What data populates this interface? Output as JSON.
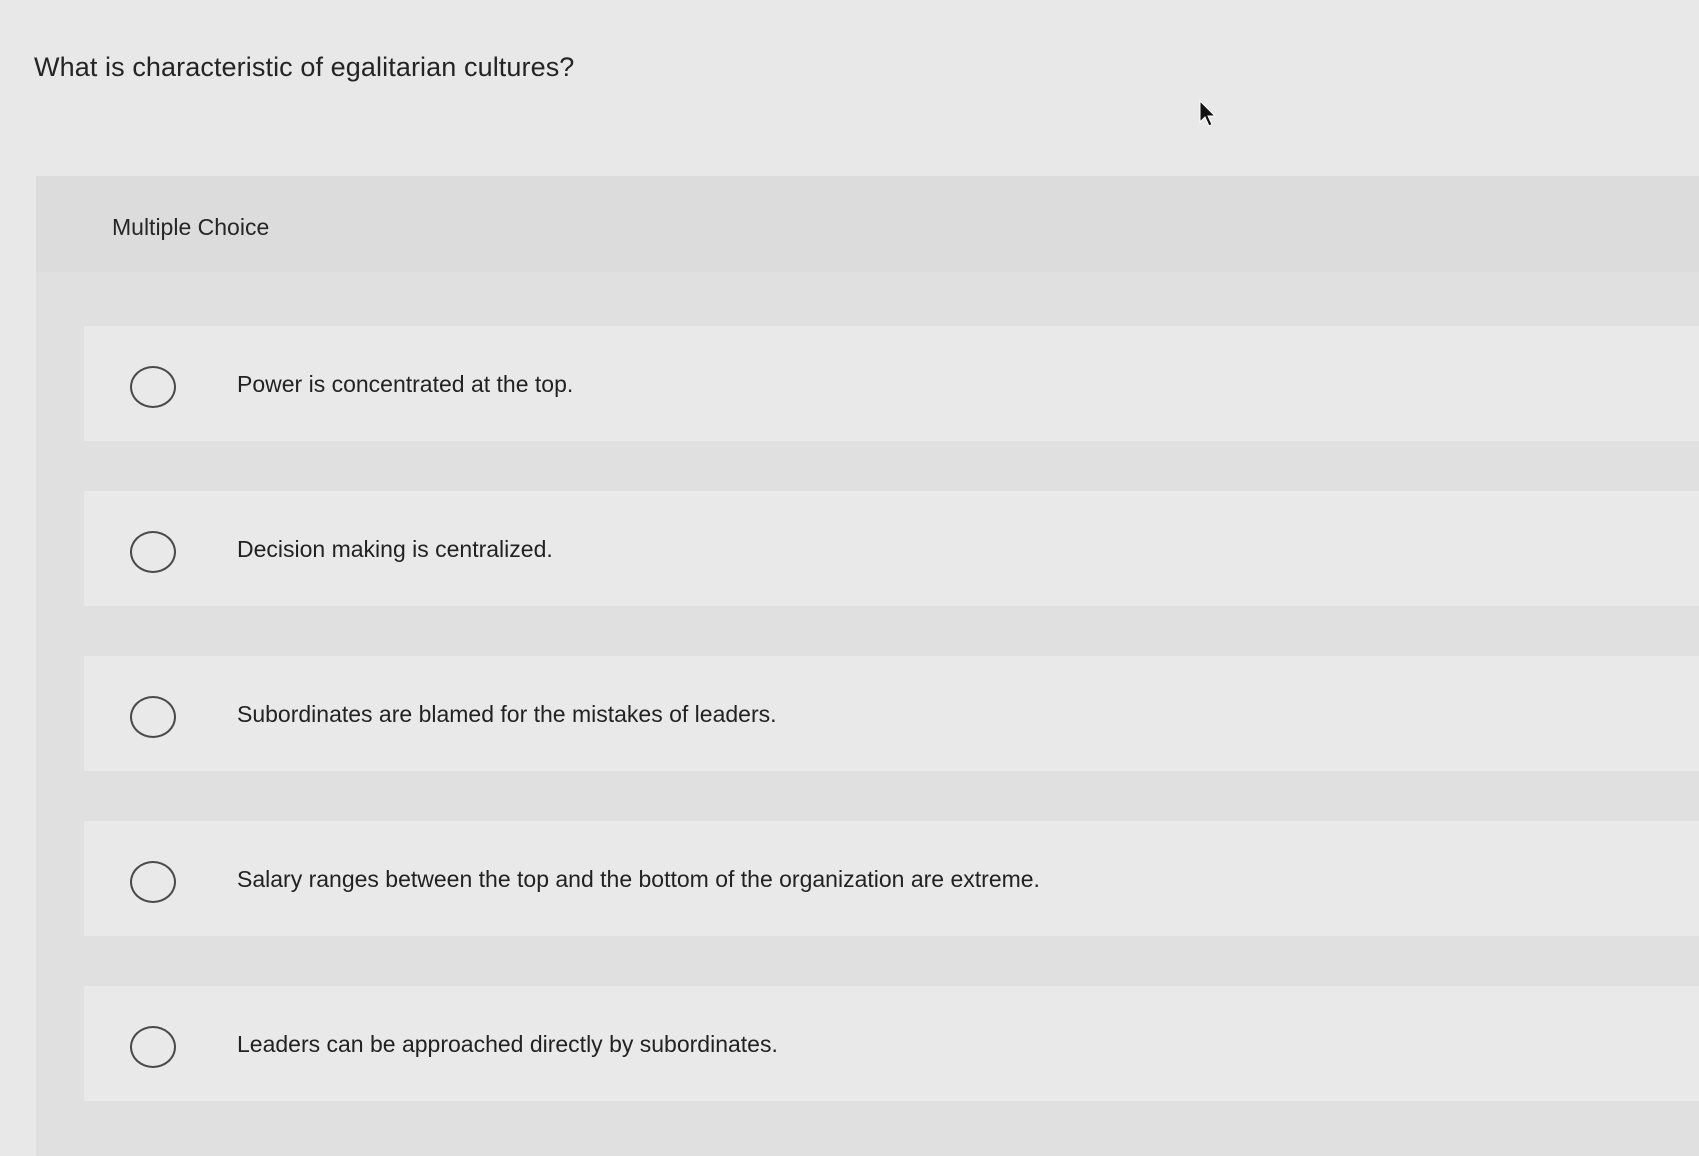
{
  "question": {
    "text": "What is characteristic of egalitarian cultures?"
  },
  "panel": {
    "type_label": "Multiple Choice"
  },
  "choices": [
    {
      "label": "Power is concentrated at the top.",
      "selected": false
    },
    {
      "label": "Decision making is centralized.",
      "selected": false
    },
    {
      "label": "Subordinates are blamed for the mistakes of leaders.",
      "selected": false
    },
    {
      "label": "Salary ranges between the top and the bottom of the organization are extreme.",
      "selected": false
    },
    {
      "label": "Leaders can be approached directly by subordinates.",
      "selected": false
    }
  ],
  "icons": {
    "radio": "radio-unselected-icon",
    "cursor": "mouse-pointer-icon"
  },
  "colors": {
    "background": "#e8e8e8",
    "panel": "#e0e0e0",
    "choice_row": "#e9e9e9",
    "text": "#222222"
  }
}
